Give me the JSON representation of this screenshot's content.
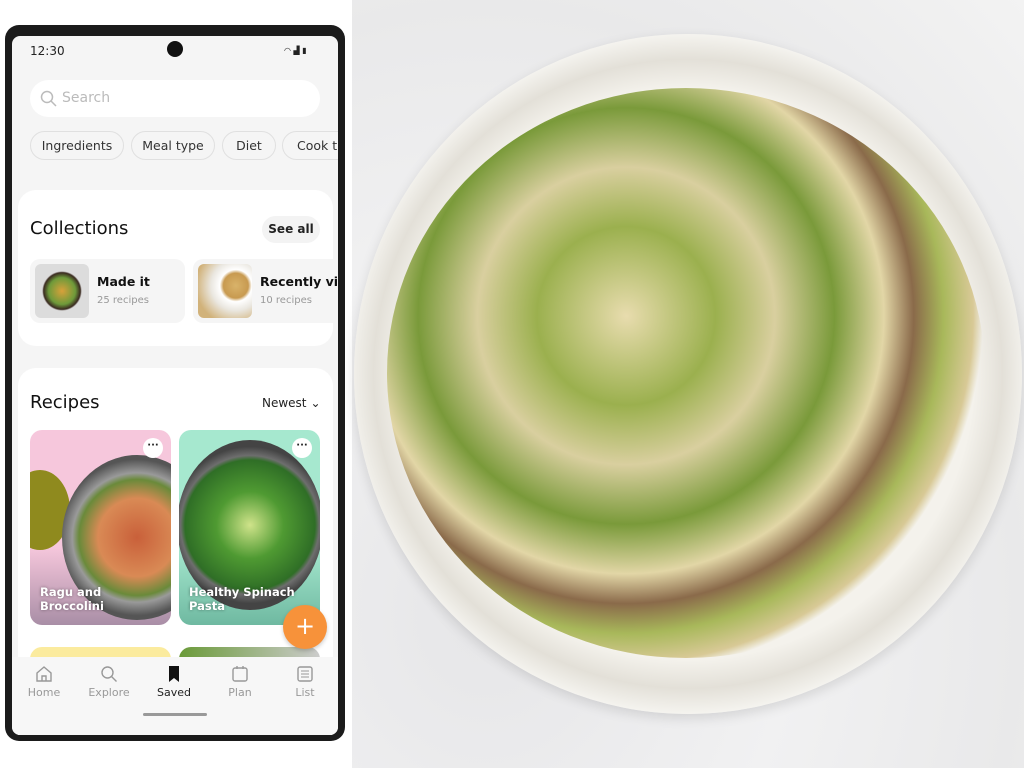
{
  "status": {
    "time": "12:30"
  },
  "search": {
    "placeholder": "Search"
  },
  "filters": [
    "Ingredients",
    "Meal type",
    "Diet",
    "Cook ti"
  ],
  "collections": {
    "title": "Collections",
    "see_all": "See all",
    "items": [
      {
        "name": "Made it",
        "count": "25 recipes"
      },
      {
        "name": "Recently view",
        "count": "10 recipes"
      }
    ]
  },
  "recipes": {
    "title": "Recipes",
    "sort": "Newest",
    "items": [
      {
        "name": "Ragu and Broccolini",
        "bg": "#f6c7dc"
      },
      {
        "name": "Healthy Spinach Pasta",
        "bg": "#a6e8cf"
      }
    ]
  },
  "fab": {
    "label": "+",
    "color": "#f7923a"
  },
  "nav": [
    {
      "label": "Home",
      "icon": "home-icon"
    },
    {
      "label": "Explore",
      "icon": "search-icon"
    },
    {
      "label": "Saved",
      "icon": "bookmark-icon",
      "active": true
    },
    {
      "label": "Plan",
      "icon": "calendar-icon"
    },
    {
      "label": "List",
      "icon": "list-icon"
    }
  ]
}
